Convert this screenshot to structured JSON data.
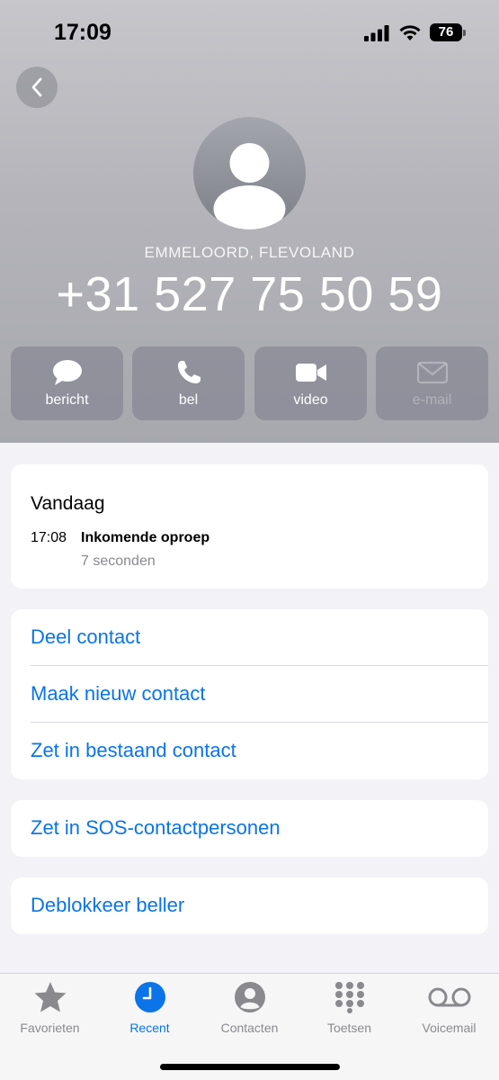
{
  "status_bar": {
    "time": "17:09",
    "battery": "76"
  },
  "contact": {
    "location": "EMMELOORD, FLEVOLAND",
    "phone_number": "+31 527 75 50 59"
  },
  "actions": [
    {
      "label": "bericht",
      "icon": "message-icon"
    },
    {
      "label": "bel",
      "icon": "phone-icon"
    },
    {
      "label": "video",
      "icon": "video-icon"
    },
    {
      "label": "e-mail",
      "icon": "mail-icon",
      "disabled": true
    }
  ],
  "recents": {
    "day": "Vandaag",
    "time": "17:08",
    "type": "Inkomende oproep",
    "duration": "7 seconden"
  },
  "options": [
    {
      "label": "Deel contact"
    },
    {
      "label": "Maak nieuw contact"
    },
    {
      "label": "Zet in bestaand contact"
    }
  ],
  "sos": {
    "label": "Zet in SOS-contactpersonen"
  },
  "block": {
    "label": "Deblokkeer beller"
  },
  "tabbar": {
    "active": "Recent",
    "accent_color": "#0a74e8",
    "tabs": [
      {
        "label": "Favorieten",
        "icon": "star-icon"
      },
      {
        "label": "Recent",
        "icon": "clock-icon"
      },
      {
        "label": "Contacten",
        "icon": "person-circle-icon"
      },
      {
        "label": "Toetsen",
        "icon": "keypad-icon"
      },
      {
        "label": "Voicemail",
        "icon": "voicemail-icon"
      }
    ]
  }
}
